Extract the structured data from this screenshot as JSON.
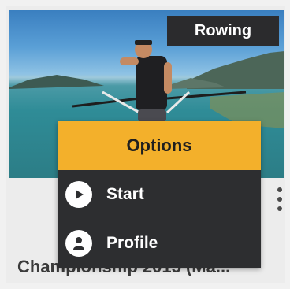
{
  "card": {
    "badge": "Rowing",
    "title": "Championship 2015 (Ma...",
    "thumbnail_icon": "rower-on-lake-image",
    "more_icon": "vertical-dots-icon"
  },
  "menu": {
    "header": "Options",
    "items": [
      {
        "label": "Start",
        "icon": "play-icon"
      },
      {
        "label": "Profile",
        "icon": "person-icon"
      }
    ]
  },
  "colors": {
    "menu_header": "#f3b02b",
    "menu_body": "#2d2e30",
    "badge_bg": "#2b2b2d",
    "title_text": "#3b3b3b"
  }
}
